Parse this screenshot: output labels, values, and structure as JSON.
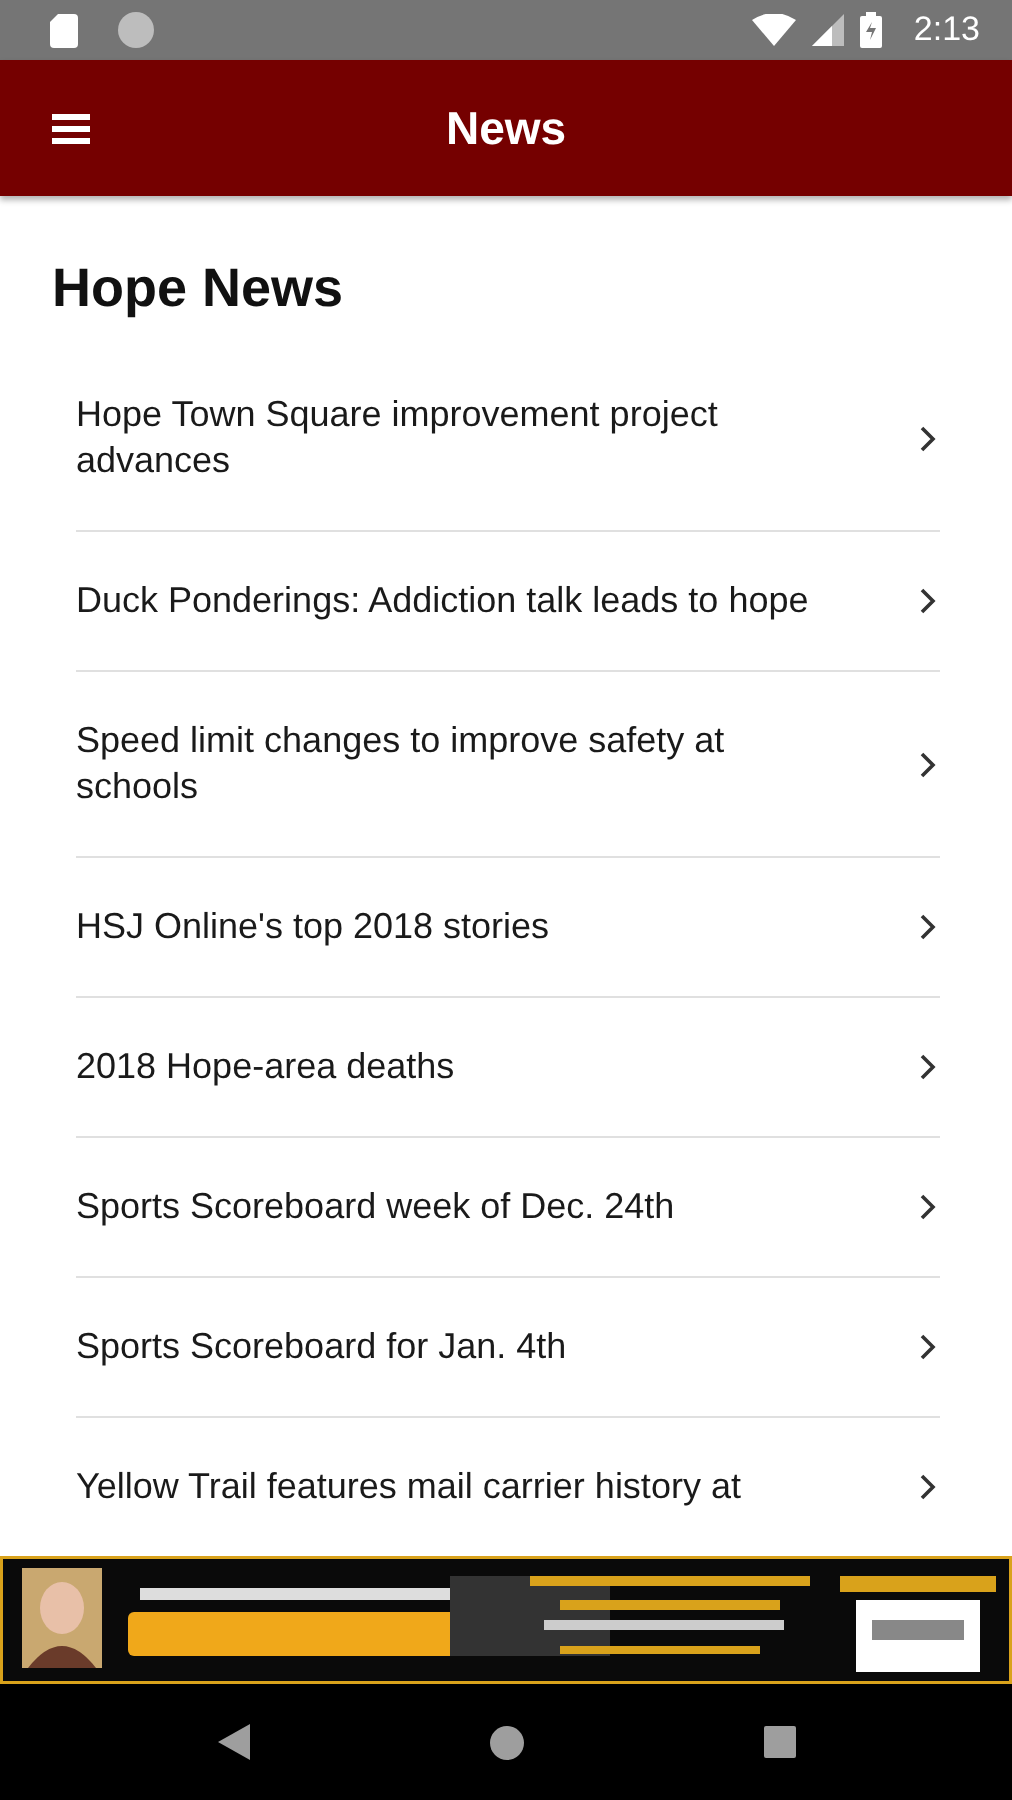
{
  "status_bar": {
    "time": "2:13"
  },
  "app_bar": {
    "title": "News"
  },
  "section": {
    "title": "Hope News"
  },
  "articles": [
    {
      "title": "Hope Town Square improvement project advances"
    },
    {
      "title": "Duck Ponderings: Addiction talk leads to hope"
    },
    {
      "title": "Speed limit changes to improve safety at schools"
    },
    {
      "title": "HSJ Online's top 2018 stories"
    },
    {
      "title": "2018 Hope-area deaths"
    },
    {
      "title": "Sports Scoreboard week of Dec. 24th"
    },
    {
      "title": "Sports Scoreboard for Jan. 4th"
    },
    {
      "title": "Yellow Trail features mail carrier history at"
    }
  ]
}
